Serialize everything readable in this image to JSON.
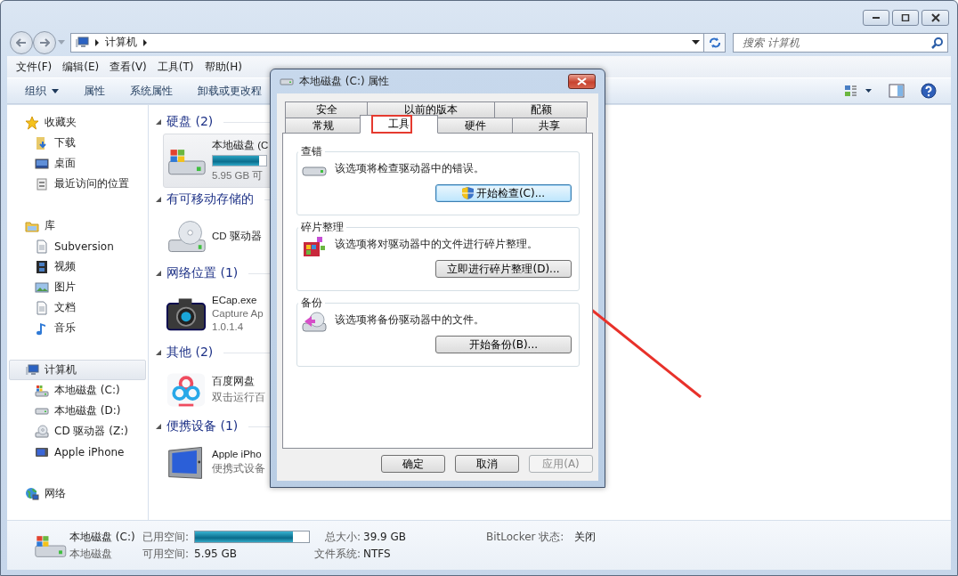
{
  "address_bar": {
    "path": [
      "计算机"
    ]
  },
  "search": {
    "placeholder": "搜索 计算机"
  },
  "menu": [
    "文件(F)",
    "编辑(E)",
    "查看(V)",
    "工具(T)",
    "帮助(H)"
  ],
  "toolbar": [
    {
      "label": "组织",
      "kind": "menu"
    },
    {
      "label": "属性",
      "kind": "button"
    },
    {
      "label": "系统属性",
      "kind": "button"
    },
    {
      "label": "卸载或更改程",
      "kind": "button"
    }
  ],
  "sidebar": {
    "sections": [
      {
        "label": "收藏夹",
        "selected": false,
        "children": [
          {
            "label": "下载",
            "selected": false
          },
          {
            "label": "桌面",
            "selected": false
          },
          {
            "label": "最近访问的位置",
            "selected": false
          }
        ]
      },
      {
        "label": "库",
        "selected": false,
        "children": [
          {
            "label": "Subversion",
            "selected": false
          },
          {
            "label": "视频",
            "selected": false
          },
          {
            "label": "图片",
            "selected": false
          },
          {
            "label": "文档",
            "selected": false
          },
          {
            "label": "音乐",
            "selected": false
          }
        ]
      },
      {
        "label": "计算机",
        "selected": true,
        "children": [
          {
            "label": "本地磁盘 (C:)",
            "selected": false
          },
          {
            "label": "本地磁盘 (D:)",
            "selected": false
          },
          {
            "label": "CD 驱动器 (Z:)",
            "selected": false
          },
          {
            "label": "Apple iPhone",
            "selected": false
          }
        ]
      },
      {
        "label": "网络",
        "selected": false
      }
    ]
  },
  "content": {
    "groups": [
      {
        "title": "硬盘 (2)",
        "items": [
          {
            "kind": "drive",
            "name": "本地磁盘 (C",
            "level": 0.86,
            "lines": [
              "5.95 GB 可"
            ],
            "selected": true
          }
        ]
      },
      {
        "title": "有可移动存储的",
        "items": [
          {
            "kind": "plain",
            "name": "CD 驱动器",
            "selected": false
          }
        ]
      },
      {
        "title": "网络位置 (1)",
        "items": [
          {
            "kind": "app",
            "name": "ECap.exe",
            "lines": [
              "Capture Ap",
              "1.0.1.4"
            ],
            "selected": false
          }
        ]
      },
      {
        "title": "其他 (2)",
        "items": [
          {
            "kind": "plain",
            "name": "百度网盘",
            "lines": [
              "双击运行百"
            ],
            "selected": false
          }
        ]
      },
      {
        "title": "便携设备 (1)",
        "items": [
          {
            "kind": "device",
            "name": "Apple iPho",
            "lines": [
              "便携式设备"
            ],
            "selected": false
          }
        ]
      }
    ]
  },
  "details": {
    "name": "本地磁盘 (C:)",
    "type": "本地磁盘",
    "fields": [
      {
        "label": "已用空间:",
        "kind": "bar",
        "level": 0.86
      },
      {
        "label": "总大小:",
        "kind": "text",
        "value": "39.9 GB"
      },
      {
        "label": "BitLocker 状态:",
        "kind": "text",
        "value": "关闭"
      },
      {
        "label": "可用空间:",
        "kind": "text",
        "value": "5.95 GB"
      },
      {
        "label": "文件系统:",
        "kind": "text",
        "value": "NTFS"
      }
    ]
  },
  "dialog": {
    "title": "本地磁盘 (C:) 属性",
    "tab_rows": [
      [
        {
          "label": "安全",
          "selected": false,
          "highlighted": false
        },
        {
          "label": "以前的版本",
          "selected": false,
          "highlighted": false
        },
        {
          "label": "配额",
          "selected": false,
          "highlighted": false
        }
      ],
      [
        {
          "label": "常规",
          "selected": false,
          "highlighted": false
        },
        {
          "label": "工具",
          "selected": true,
          "highlighted": true
        },
        {
          "label": "硬件",
          "selected": false,
          "highlighted": false
        },
        {
          "label": "共享",
          "selected": false,
          "highlighted": false
        }
      ]
    ],
    "sections": [
      {
        "title": "查错",
        "text": "该选项将检查驱动器中的错误。",
        "button": "开始检查(C)...",
        "elevated": true,
        "focused": true
      },
      {
        "title": "碎片整理",
        "text": "该选项将对驱动器中的文件进行碎片整理。",
        "button": "立即进行碎片整理(D)...",
        "elevated": false,
        "focused": false
      },
      {
        "title": "备份",
        "text": "该选项将备份驱动器中的文件。",
        "button": "开始备份(B)...",
        "elevated": false,
        "focused": false
      }
    ],
    "buttons": [
      {
        "label": "确定",
        "disabled": false
      },
      {
        "label": "取消",
        "disabled": false
      },
      {
        "label": "应用(A)",
        "disabled": true
      }
    ]
  }
}
